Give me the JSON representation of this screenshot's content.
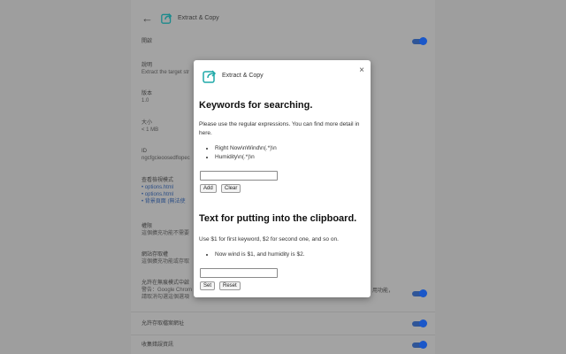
{
  "background": {
    "title": "Extract & Copy",
    "enabled_label": "開啟",
    "rows": [
      {
        "label": "說明",
        "value": "Extract the target str"
      },
      {
        "label": "版本",
        "value": "1.0"
      },
      {
        "label": "大小",
        "value": "< 1 MB"
      },
      {
        "label": "ID",
        "value": "ngcfgcieoosedflopec"
      },
      {
        "label": "查看檢視模式",
        "links": [
          "options.html",
          "options.html",
          "背景頁面 (無法使"
        ]
      },
      {
        "label": "權限",
        "value": "這個擴充功能不需要"
      },
      {
        "label": "網站存取權",
        "value": "這個擴充功能或存取"
      },
      {
        "label": "允許在無痕模式中啟",
        "value": "警告：Google Chrom",
        "value2": "請取消勾選這個選項"
      },
      {
        "label": "允許存取檔案網址"
      },
      {
        "label": "收集錯誤資訊"
      }
    ],
    "trailing_text": "用功能，"
  },
  "modal": {
    "title": "Extract & Copy",
    "close": "×",
    "section1": {
      "heading": "Keywords for searching.",
      "desc": "Please use the regular expressions. You can find more detail in here.",
      "examples": [
        "Right Now\\nWind\\n(.*)\\n",
        "Humidity\\n(.*)\\n"
      ],
      "input_value": "",
      "add_label": "Add",
      "clear_label": "Clear"
    },
    "section2": {
      "heading": "Text for putting into the clipboard.",
      "desc": "Use $1 for first keyword, $2 for second one, and so on.",
      "examples": [
        "Now wind is $1, and humidity is $2."
      ],
      "input_value": "",
      "set_label": "Set",
      "reset_label": "Reset"
    }
  }
}
